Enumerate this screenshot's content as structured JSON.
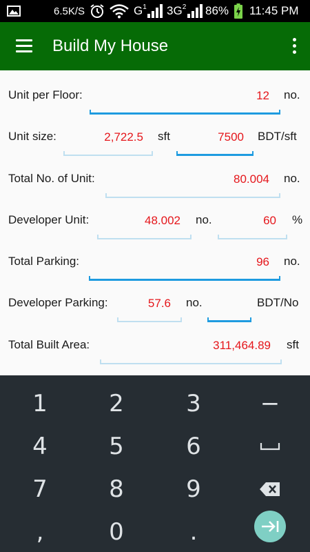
{
  "status_bar": {
    "speed": "6.5K/S",
    "network_g": "G",
    "network_g_index": "1",
    "network_3g": "3G",
    "network_3g_index": "2",
    "battery": "86%",
    "time": "11:45 PM"
  },
  "app_bar": {
    "title": "Build My House",
    "menu_icon": "hamburger-menu-icon",
    "overflow_icon": "more-vert-icon"
  },
  "form": {
    "unit_per_floor": {
      "label": "Unit per Floor:",
      "value": "12",
      "unit": "no."
    },
    "unit_size": {
      "label": "Unit size:",
      "value": "2,722.5",
      "unit": "sft",
      "rate_value": "7500",
      "rate_unit": "BDT/sft"
    },
    "total_units": {
      "label": "Total No. of Unit:",
      "value": "80.004",
      "unit": "no."
    },
    "developer_unit": {
      "label": "Developer Unit:",
      "value": "48.002",
      "unit": "no.",
      "percent_value": "60",
      "percent_unit": "%"
    },
    "total_parking": {
      "label": "Total Parking:",
      "value": "96",
      "unit": "no."
    },
    "developer_parking": {
      "label": "Developer Parking:",
      "value": "57.6",
      "unit": "no.",
      "rate_value": "",
      "rate_unit": "BDT/No"
    },
    "total_built_area": {
      "label": "Total Built Area:",
      "value": "311,464.89",
      "unit": "sft"
    }
  },
  "keyboard": {
    "rows": [
      [
        "1",
        "2",
        "3",
        "−"
      ],
      [
        "4",
        "5",
        "6",
        "␣"
      ],
      [
        "7",
        "8",
        "9",
        "backspace"
      ],
      [
        ",",
        "0",
        ".",
        "next"
      ]
    ],
    "k1": "1",
    "k2": "2",
    "k3": "3",
    "k_minus": "−",
    "k4": "4",
    "k5": "5",
    "k6": "6",
    "k7": "7",
    "k8": "8",
    "k9": "9",
    "k_comma": ",",
    "k0": "0",
    "k_dot": ".",
    "icons": {
      "space": "space-icon",
      "backspace": "backspace-icon",
      "next": "next-field-icon"
    },
    "accent_color": "#7fcfc4"
  },
  "colors": {
    "app_bar": "#066b06",
    "value_text": "#e5161b",
    "active_underline": "#1e9be0",
    "inactive_underline": "#bfdff0",
    "keyboard_bg": "#262d33"
  }
}
